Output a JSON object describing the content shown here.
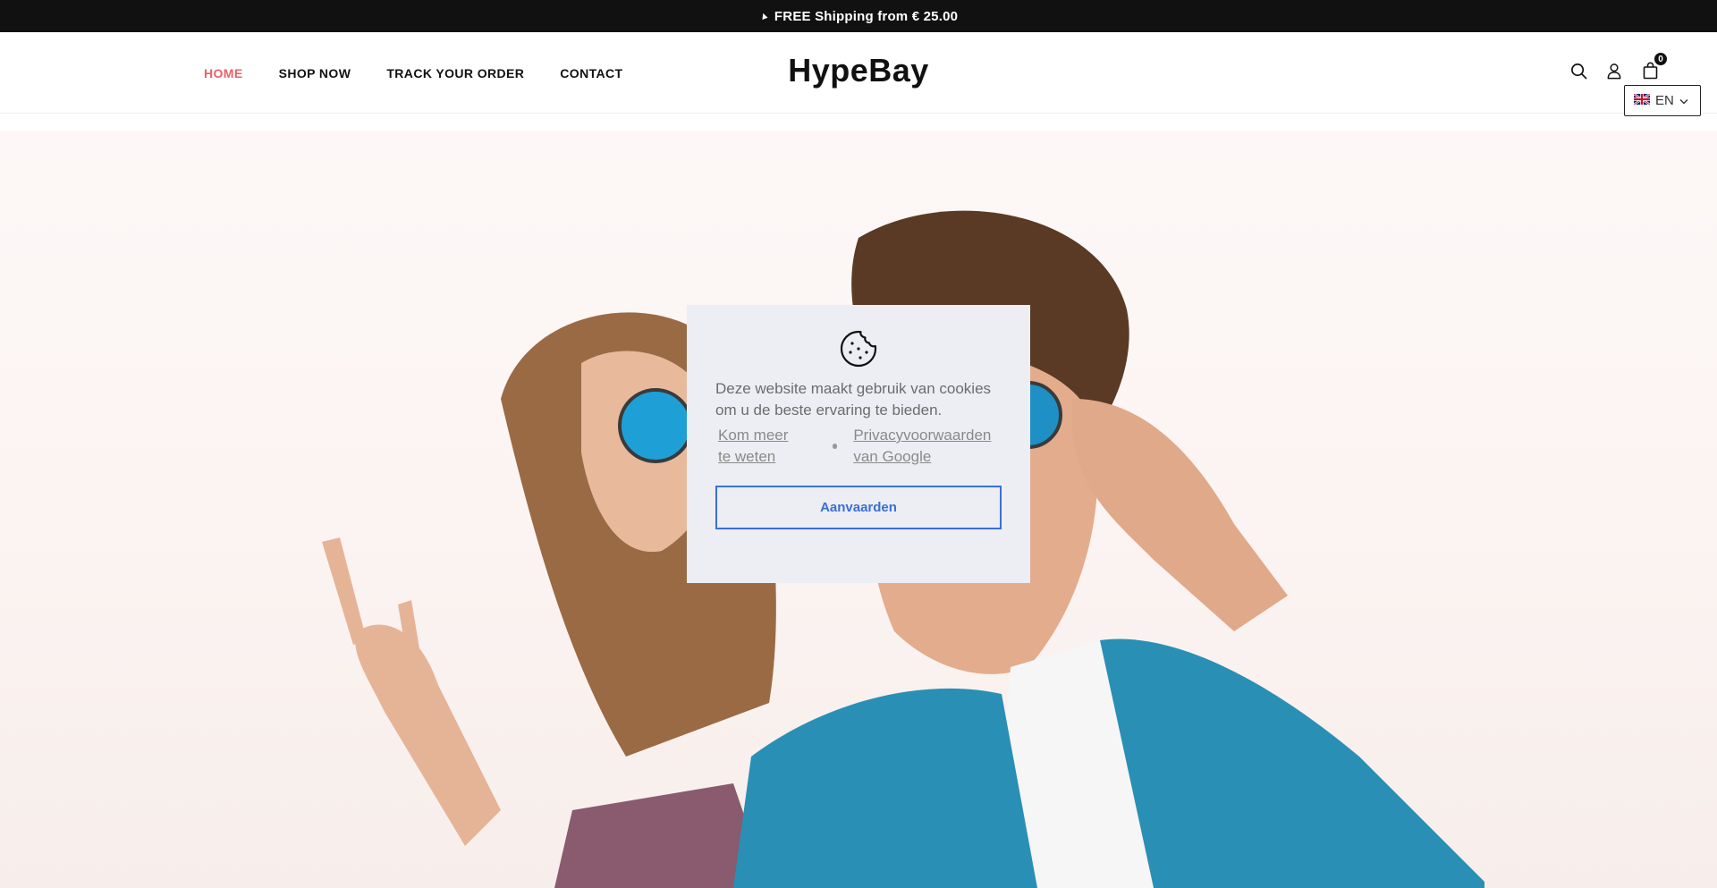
{
  "announcement": {
    "text": "FREE Shipping from € 25.00"
  },
  "header": {
    "nav": [
      {
        "label": "HOME",
        "active": true
      },
      {
        "label": "SHOP NOW",
        "active": false
      },
      {
        "label": "TRACK YOUR ORDER",
        "active": false
      },
      {
        "label": "CONTACT",
        "active": false
      }
    ],
    "logo": "HypeBay",
    "cart_count": "0",
    "language": "EN"
  },
  "cookie_banner": {
    "message": "Deze website maakt gebruik van cookies om u de beste ervaring te bieden.",
    "link_learn_more": "Kom meer te weten",
    "link_privacy": "Privacyvoorwaarden van Google",
    "accept_label": "Aanvaarden"
  },
  "colors": {
    "announcement_bg": "#111111",
    "nav_active": "#e8606a",
    "accept_accent": "#3a6fd8",
    "cookie_bg": "#eceef3"
  },
  "icons": [
    "paper-plane-icon",
    "search-icon",
    "user-icon",
    "shopping-bag-icon",
    "uk-flag-icon",
    "chevron-down-icon",
    "cookie-icon"
  ]
}
